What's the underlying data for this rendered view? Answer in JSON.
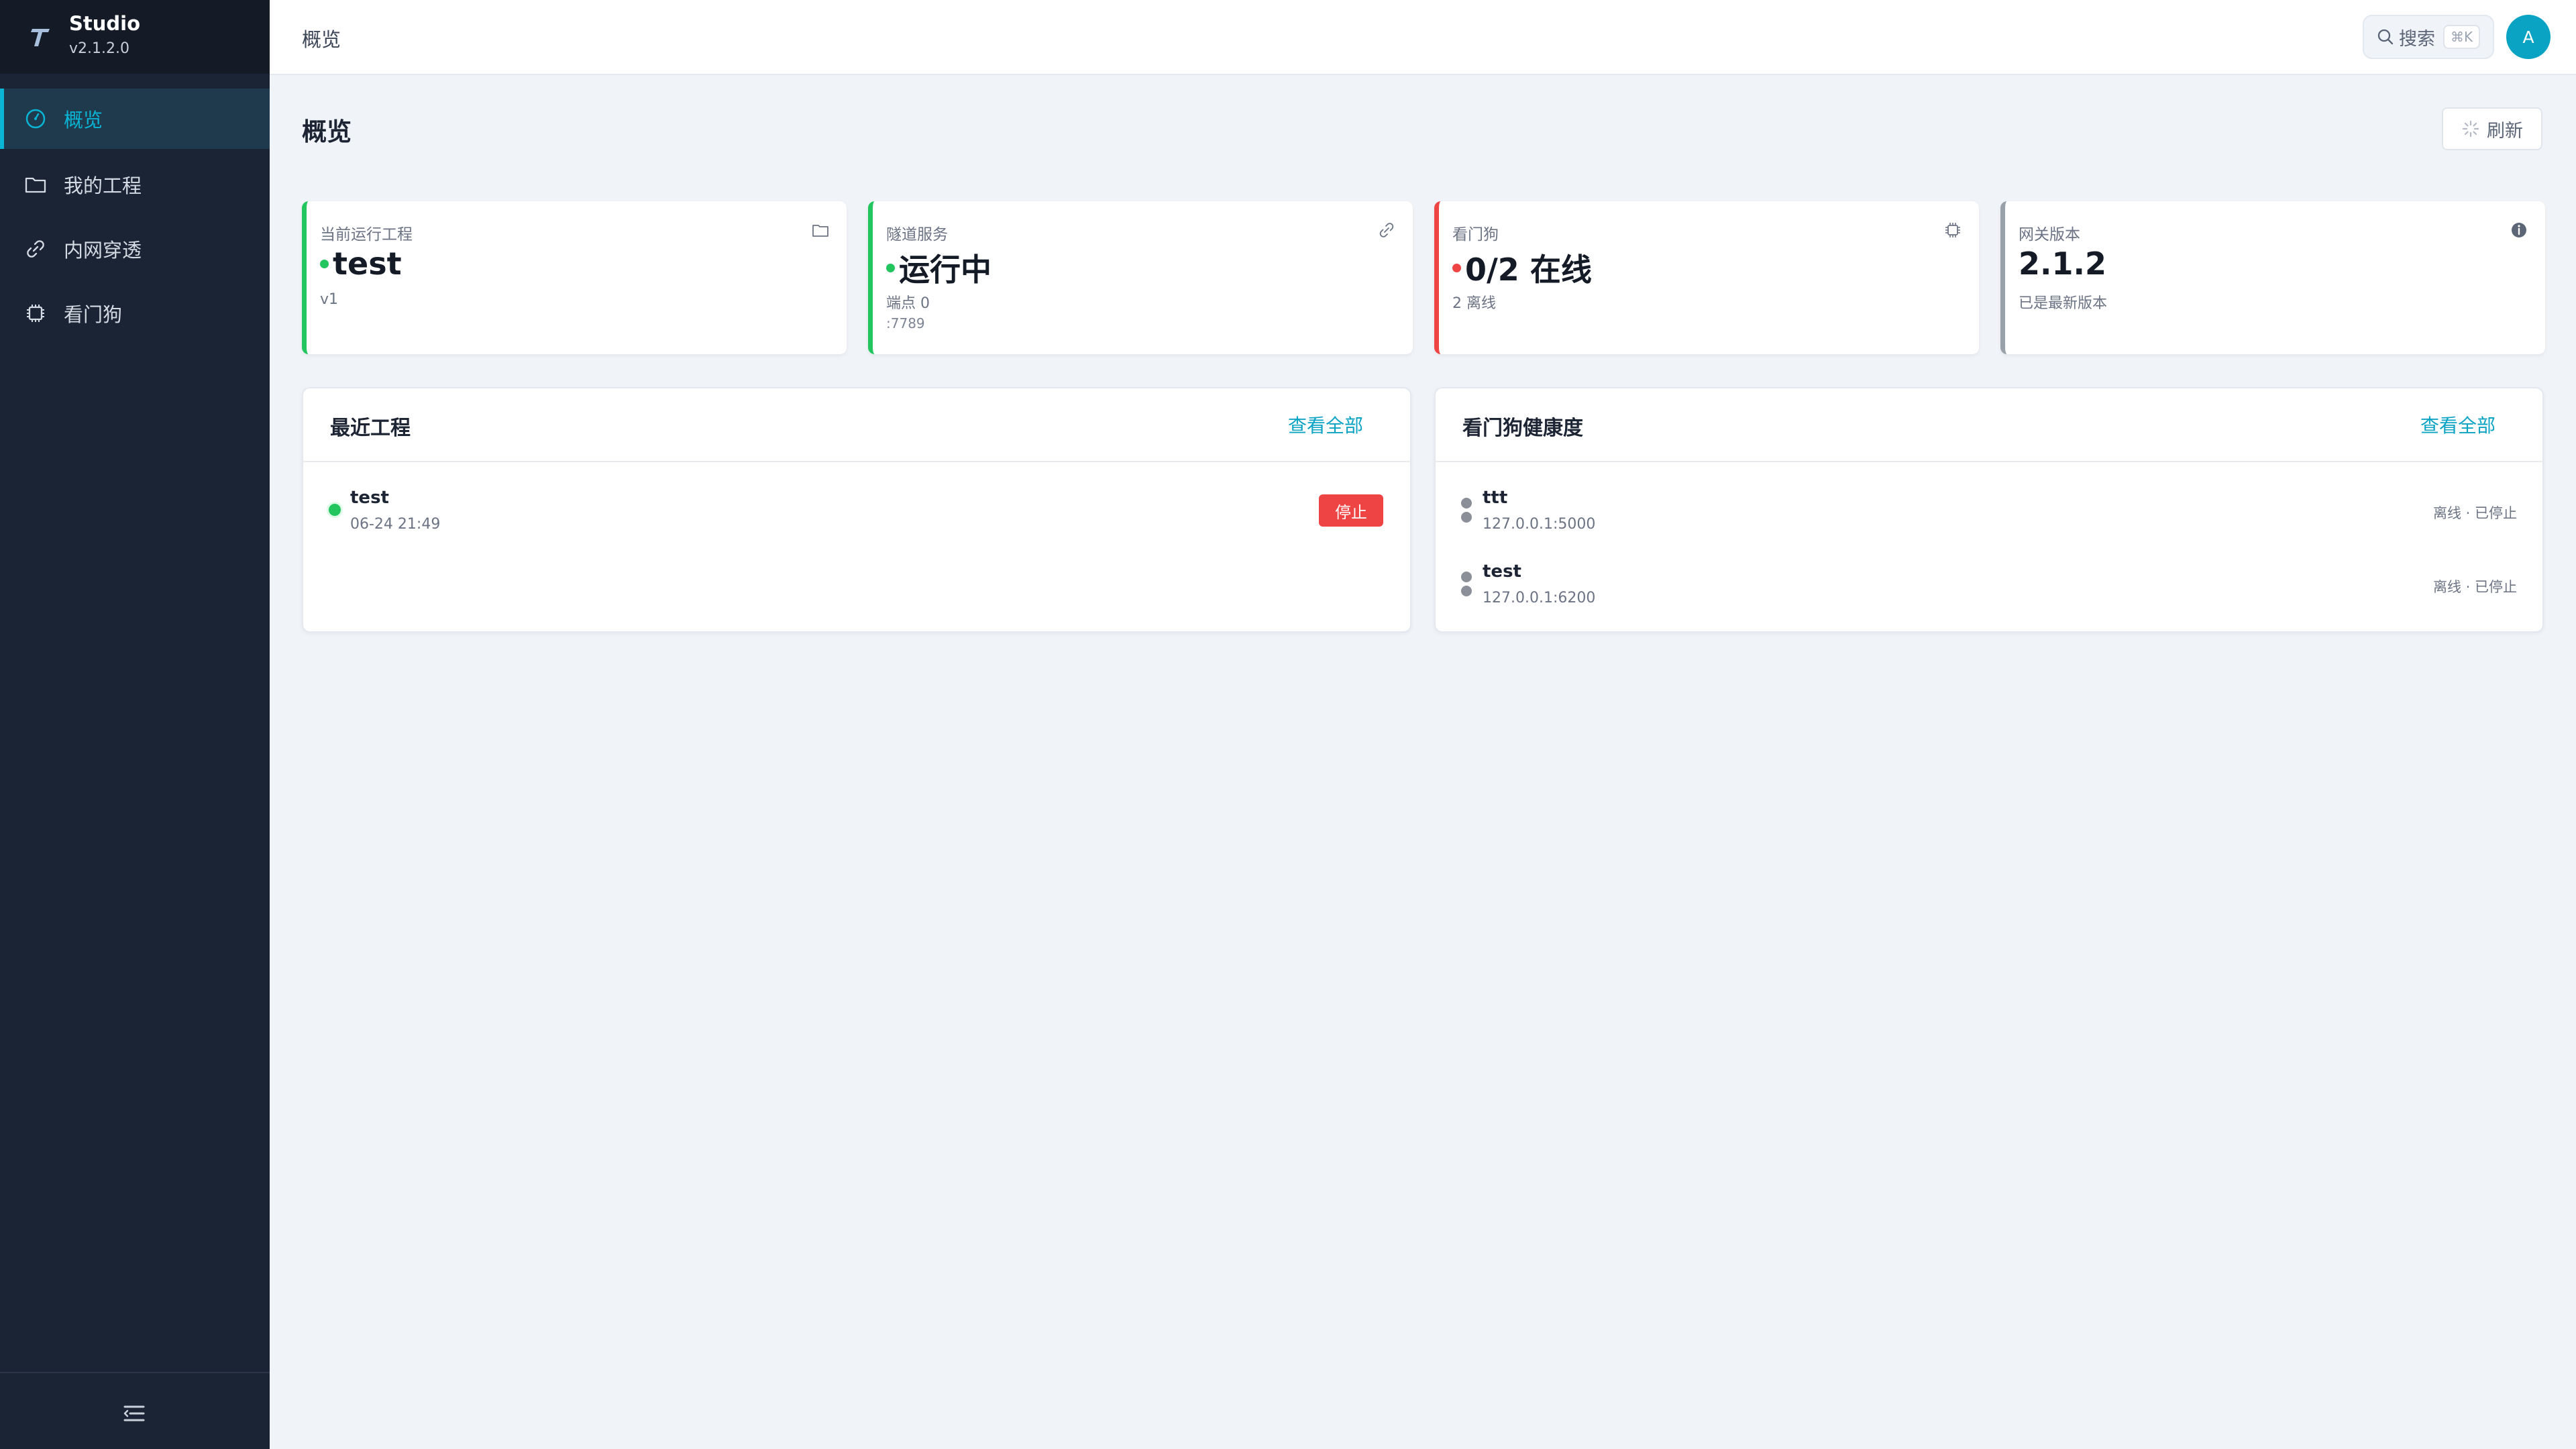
{
  "brand": {
    "name": "Studio",
    "version": "v2.1.2.0"
  },
  "sidebar": {
    "items": [
      {
        "label": "概览",
        "icon": "gauge-icon",
        "active": true
      },
      {
        "label": "我的工程",
        "icon": "folder-icon",
        "active": false
      },
      {
        "label": "内网穿透",
        "icon": "link-icon",
        "active": false
      },
      {
        "label": "看门狗",
        "icon": "chip-icon",
        "active": false
      }
    ]
  },
  "topbar": {
    "breadcrumb": "概览",
    "search_label": "搜索",
    "search_shortcut": "⌘K",
    "avatar_initial": "A"
  },
  "page": {
    "title": "概览",
    "refresh_label": "刷新"
  },
  "stats": [
    {
      "label": "当前运行工程",
      "value": "test",
      "sub": "v1",
      "sub2": "",
      "accent": "#22c55e",
      "dot": "#22c55e",
      "icon": "folder-icon"
    },
    {
      "label": "隧道服务",
      "value": "运行中",
      "sub": "端点 0",
      "sub2": ":7789",
      "accent": "#22c55e",
      "dot": "#22c55e",
      "icon": "link-icon"
    },
    {
      "label": "看门狗",
      "value": "0/2 在线",
      "sub": "2 离线",
      "sub2": "",
      "accent": "#ef4444",
      "dot": "#ef4444",
      "icon": "chip-icon"
    },
    {
      "label": "网关版本",
      "value": "2.1.2",
      "sub": "已是最新版本",
      "sub2": "",
      "accent": "#9aa0a8",
      "dot": "",
      "icon": "info-icon"
    }
  ],
  "recent_projects": {
    "title": "最近工程",
    "view_all": "查看全部",
    "items": [
      {
        "name": "test",
        "time": "06-24 21:49",
        "status_color": "#22c55e",
        "action": "停止"
      }
    ]
  },
  "watchdog_health": {
    "title": "看门狗健康度",
    "view_all": "查看全部",
    "items": [
      {
        "name": "ttt",
        "address": "127.0.0.1:5000",
        "status": "离线 · 已停止"
      },
      {
        "name": "test",
        "address": "127.0.0.1:6200",
        "status": "离线 · 已停止"
      }
    ]
  },
  "colors": {
    "accent": "#0ab4d4",
    "sidebar_bg": "#1b2434",
    "danger": "#ef4444",
    "success": "#22c55e"
  }
}
